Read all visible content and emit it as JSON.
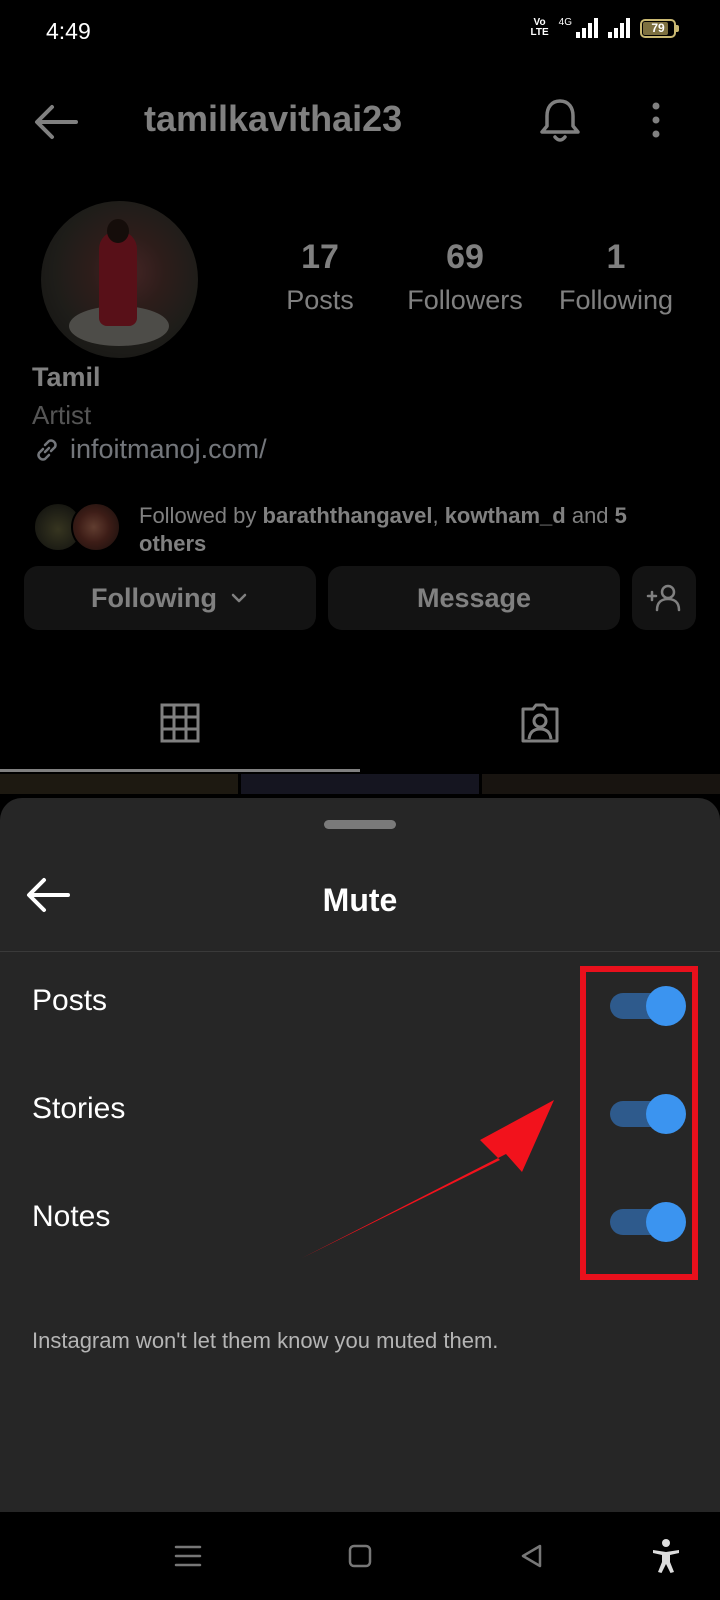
{
  "status_bar": {
    "time": "4:49",
    "volte_top": "Vo",
    "volte_bottom": "LTE",
    "network": "4G",
    "battery": "79"
  },
  "profile": {
    "username": "tamilkavithai23",
    "stats": [
      {
        "value": "17",
        "label": "Posts"
      },
      {
        "value": "69",
        "label": "Followers"
      },
      {
        "value": "1",
        "label": "Following"
      }
    ],
    "full_name": "Tamil",
    "category": "Artist",
    "link": "infoitmanoj.com/",
    "followed_by": {
      "prefix": "Followed by ",
      "user1": "baraththangavel",
      "separator": ", ",
      "user2": "kowtham_d",
      "middle": " and ",
      "others": "5 others"
    },
    "buttons": {
      "following": "Following",
      "message": "Message"
    }
  },
  "sheet": {
    "title": "Mute",
    "rows": [
      {
        "label": "Posts",
        "on": true
      },
      {
        "label": "Stories",
        "on": true
      },
      {
        "label": "Notes",
        "on": true
      }
    ],
    "hint": "Instagram won't let them know you muted them."
  },
  "colors": {
    "background": "#000000",
    "sheet": "#262626",
    "toggle_knob": "#3b94f0",
    "toggle_track": "#2e5a8c",
    "annotation": "#e8101c"
  },
  "icons": {
    "back": "arrow-left-icon",
    "bell": "bell-icon",
    "more": "more-vertical-icon",
    "link": "link-icon",
    "chevron": "chevron-down-icon",
    "add_user": "add-user-icon",
    "grid": "grid-icon",
    "tagged": "tagged-person-icon"
  }
}
